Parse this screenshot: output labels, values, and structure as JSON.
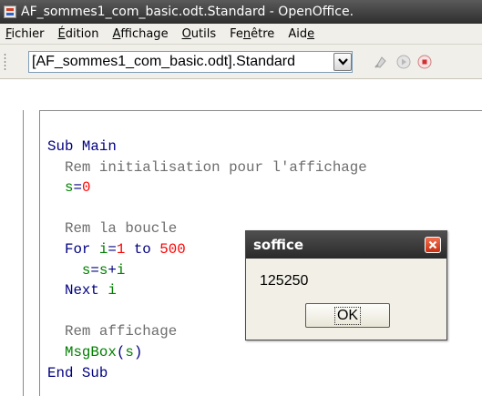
{
  "window": {
    "title": "AF_sommes1_com_basic.odt.Standard - OpenOffice."
  },
  "menu": [
    {
      "mnemonic": "F",
      "rest": "ichier"
    },
    {
      "pre": "",
      "mnemonic": "É",
      "rest": "dition"
    },
    {
      "mnemonic": "A",
      "rest": "ffichage"
    },
    {
      "mnemonic": "O",
      "rest": "utils"
    },
    {
      "pre": "Fe",
      "mnemonic": "n",
      "rest": "être"
    },
    {
      "pre": "Aid",
      "mnemonic": "e",
      "rest": ""
    }
  ],
  "toolbar": {
    "library_combo_value": "[AF_sommes1_com_basic.odt].Standard",
    "icons": [
      "compile-icon",
      "run-icon",
      "stop-icon"
    ]
  },
  "code": {
    "line1": "Sub Main",
    "line2": "  Rem initialisation pour l'affichage",
    "line3_var": "s",
    "line3_op": "=",
    "line3_num": "0",
    "line5": "  Rem la boucle",
    "line6_kw1": "For ",
    "line6_var": "i",
    "line6_op": "=",
    "line6_num1": "1",
    "line6_kw2": " to ",
    "line6_num2": "500",
    "line7_var1": "s",
    "line7_op": "=",
    "line7_var2": "s",
    "line7_plus": "+",
    "line7_var3": "i",
    "line8_kw": "Next ",
    "line8_var": "i",
    "line10": "  Rem affichage",
    "line11_fn": "MsgBox",
    "line11_open": "(",
    "line11_arg": "s",
    "line11_close": ")",
    "line12": "End Sub"
  },
  "dialog": {
    "title": "soffice",
    "message": "125250",
    "ok_label": "OK"
  }
}
